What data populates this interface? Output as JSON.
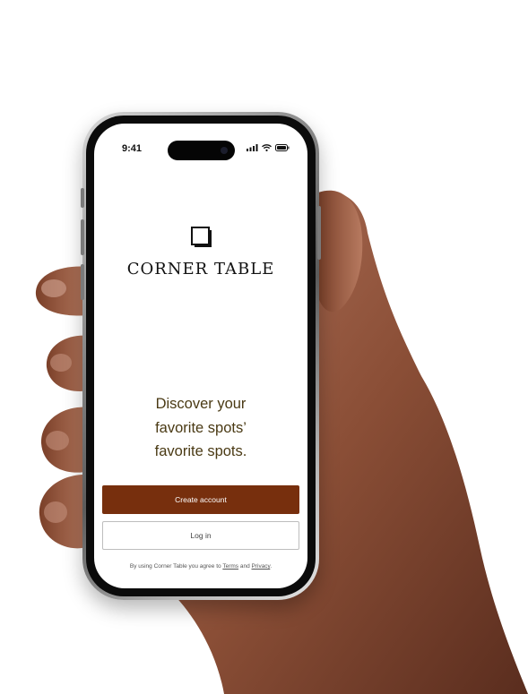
{
  "status_bar": {
    "time": "9:41",
    "icons": [
      "signal-icon",
      "wifi-icon",
      "battery-icon"
    ]
  },
  "brand": {
    "logo_icon": "corner-square-logo-icon",
    "name": "CORNER TABLE"
  },
  "headline": {
    "line1": "Discover your",
    "line2": "favorite spots’",
    "line3": "favorite spots."
  },
  "actions": {
    "create_account_label": "Create account",
    "login_label": "Log in"
  },
  "legal": {
    "prefix": "By using Corner Table you agree to ",
    "terms_label": "Terms",
    "and_text": " and ",
    "privacy_label": "Privacy",
    "suffix": "."
  },
  "colors": {
    "primary_button": "#772f0d",
    "headline_text": "#4a3a14",
    "screen_background": "#ffffff"
  }
}
